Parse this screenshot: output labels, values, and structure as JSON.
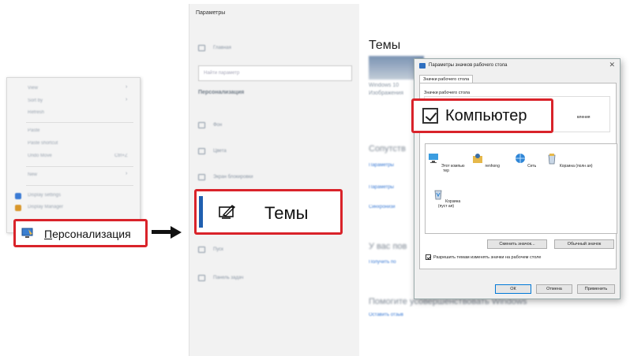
{
  "context_menu": {
    "blurred_items": [
      {
        "label": "View",
        "arrow": "›"
      },
      {
        "label": "Sort by",
        "arrow": "›"
      },
      {
        "label": "Refresh"
      },
      {
        "label": "Paste"
      },
      {
        "label": "Paste shortcut"
      },
      {
        "label": "Undo Move",
        "shortcut": "Ctrl+Z"
      },
      {
        "label": "New",
        "arrow": "›"
      },
      {
        "label": "Display settings"
      },
      {
        "label": "Display Manager"
      }
    ],
    "personalization_label": "Персонализация"
  },
  "settings": {
    "window_title": "Параметры",
    "controls": [
      "–",
      "□",
      "✕"
    ],
    "sidebar_blurred": {
      "home": "Главная",
      "search_placeholder": "Найти параметр",
      "section": "Персонализация",
      "items": [
        "Фон",
        "Цвета",
        "Экран блокировки"
      ],
      "items_after": [
        "Пуск",
        "Панель задач"
      ]
    },
    "selected_item_label": "Темы",
    "main": {
      "heading": "Темы",
      "blurred_lines": [
        "Windows 10",
        "Изображения",
        "Сопутств",
        "Параметры",
        "Параметры",
        "Синхронизи",
        "У вас пов",
        "Получить по",
        "Помогите усовершенствовать Windows",
        "Оставить отзыв"
      ]
    }
  },
  "dialog": {
    "title": "Параметры значков рабочего стола",
    "close": "✕",
    "tab": "Значки рабочего стола",
    "group_title": "Значки рабочего стола",
    "behind_text": "вления",
    "computer_label": "Компьютер",
    "icons": [
      {
        "label": "Этот компью тер",
        "icon": "computer-icon"
      },
      {
        "label": "renhong",
        "icon": "user-folder-icon"
      },
      {
        "label": "Сеть",
        "icon": "network-icon"
      },
      {
        "label": "Корзина (полн ая)",
        "icon": "recycle-bin-full-icon"
      },
      {
        "label": "Корзина (пуст ая)",
        "icon": "recycle-bin-empty-icon"
      }
    ],
    "change_icon_btn": "Сменить значок...",
    "default_icon_btn": "Обычный значок",
    "allow_themes_label": "Разрешить темам изменять значки на рабочем столе",
    "ok_btn": "ОК",
    "cancel_btn": "Отмена",
    "apply_btn": "Применить"
  },
  "colors": {
    "highlight": "#d9232a",
    "accent": "#1f5fb0"
  }
}
